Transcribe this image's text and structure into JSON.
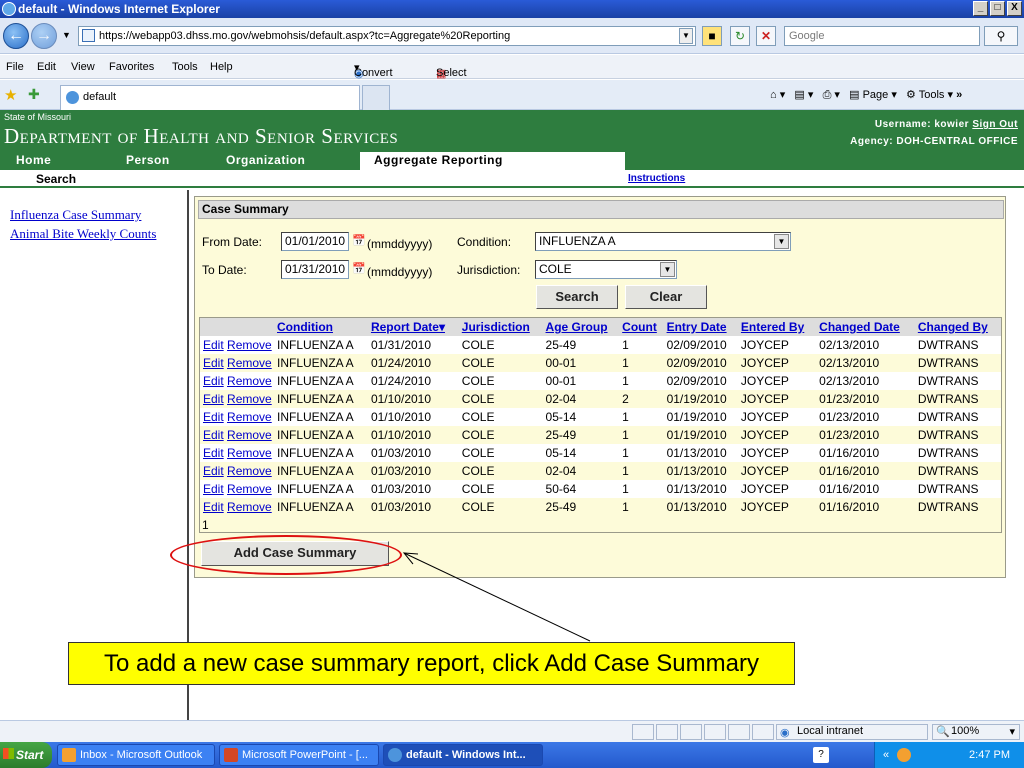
{
  "window": {
    "title": "default - Windows Internet Explorer",
    "btn_min": "_",
    "btn_max": "□",
    "btn_close": "X"
  },
  "address": {
    "url": "https://webapp03.dhss.mo.gov/webmohsis/default.aspx?tc=Aggregate%20Reporting",
    "search_placeholder": "Google"
  },
  "menu": [
    "File",
    "Edit",
    "View",
    "Favorites",
    "Tools",
    "Help"
  ],
  "toolbar": {
    "convert": "Convert",
    "select": "Select"
  },
  "tab": {
    "label": "default"
  },
  "command_bar": {
    "page": "Page",
    "tools": "Tools"
  },
  "site": {
    "state": "State of Missouri",
    "department": "Department of Health and Senior Services",
    "username_label": "Username:",
    "username": "kowier",
    "sign_out": "Sign Out",
    "agency_label": "Agency:",
    "agency": "DOH-CENTRAL OFFICE",
    "nav": [
      "Home",
      "Person",
      "Organization",
      "Aggregate Reporting"
    ],
    "subnav_search": "Search",
    "instructions": "Instructions"
  },
  "leftnav": [
    "Influenza Case Summary",
    "Animal Bite Weekly Counts"
  ],
  "panel": {
    "title": "Case Summary",
    "from_date_label": "From Date:",
    "from_date": "01/01/2010",
    "to_date_label": "To Date:",
    "to_date": "01/31/2010",
    "date_hint": "(mmddyyyy)",
    "condition_label": "Condition:",
    "condition": "INFLUENZA A",
    "jurisdiction_label": "Jurisdiction:",
    "jurisdiction": "COLE",
    "search_btn": "Search",
    "clear_btn": "Clear",
    "add_btn": "Add Case Summary"
  },
  "grid": {
    "headers": [
      "Condition",
      "Report Date▾",
      "Jurisdiction",
      "Age Group",
      "Count",
      "Entry Date",
      "Entered By",
      "Changed Date",
      "Changed By"
    ],
    "edit": "Edit",
    "remove": "Remove",
    "rows": [
      [
        "INFLUENZA A",
        "01/31/2010",
        "COLE",
        "25-49",
        "1",
        "02/09/2010",
        "JOYCEP",
        "02/13/2010",
        "DWTRANS"
      ],
      [
        "INFLUENZA A",
        "01/24/2010",
        "COLE",
        "00-01",
        "1",
        "02/09/2010",
        "JOYCEP",
        "02/13/2010",
        "DWTRANS"
      ],
      [
        "INFLUENZA A",
        "01/24/2010",
        "COLE",
        "00-01",
        "1",
        "02/09/2010",
        "JOYCEP",
        "02/13/2010",
        "DWTRANS"
      ],
      [
        "INFLUENZA A",
        "01/10/2010",
        "COLE",
        "02-04",
        "2",
        "01/19/2010",
        "JOYCEP",
        "01/23/2010",
        "DWTRANS"
      ],
      [
        "INFLUENZA A",
        "01/10/2010",
        "COLE",
        "05-14",
        "1",
        "01/19/2010",
        "JOYCEP",
        "01/23/2010",
        "DWTRANS"
      ],
      [
        "INFLUENZA A",
        "01/10/2010",
        "COLE",
        "25-49",
        "1",
        "01/19/2010",
        "JOYCEP",
        "01/23/2010",
        "DWTRANS"
      ],
      [
        "INFLUENZA A",
        "01/03/2010",
        "COLE",
        "05-14",
        "1",
        "01/13/2010",
        "JOYCEP",
        "01/16/2010",
        "DWTRANS"
      ],
      [
        "INFLUENZA A",
        "01/03/2010",
        "COLE",
        "02-04",
        "1",
        "01/13/2010",
        "JOYCEP",
        "01/16/2010",
        "DWTRANS"
      ],
      [
        "INFLUENZA A",
        "01/03/2010",
        "COLE",
        "50-64",
        "1",
        "01/13/2010",
        "JOYCEP",
        "01/16/2010",
        "DWTRANS"
      ],
      [
        "INFLUENZA A",
        "01/03/2010",
        "COLE",
        "25-49",
        "1",
        "01/13/2010",
        "JOYCEP",
        "01/16/2010",
        "DWTRANS"
      ]
    ],
    "page": "1"
  },
  "callout": "To add a new case summary report, click Add Case Summary",
  "status": {
    "zone": "Local intranet",
    "zoom": "100%"
  },
  "taskbar": {
    "start": "Start",
    "items": [
      "Inbox - Microsoft Outlook",
      "Microsoft PowerPoint - [...",
      "default - Windows Int..."
    ],
    "clock": "2:47 PM"
  }
}
